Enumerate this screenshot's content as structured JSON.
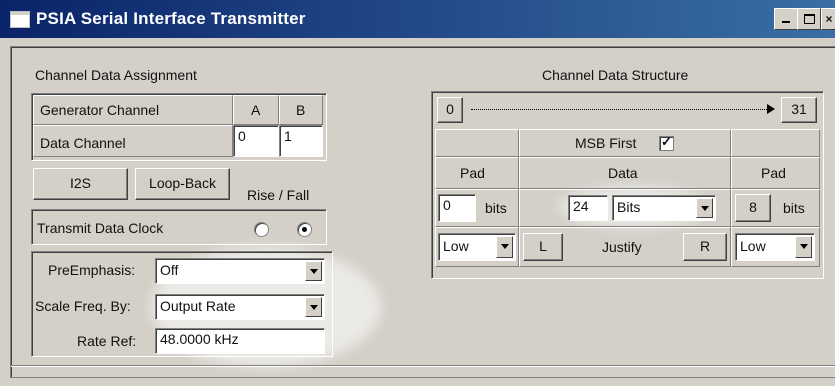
{
  "window": {
    "title": "PSIA Serial Interface Transmitter"
  },
  "assignment": {
    "title": "Channel Data Assignment",
    "generator_label": "Generator Channel",
    "data_label": "Data Channel",
    "col_a": "A",
    "col_b": "B",
    "data_a": "0",
    "data_b": "1",
    "i2s_label": "I2S",
    "loopback_label": "Loop-Back",
    "rise_fall_label": "Rise / Fall",
    "transmit_clock_label": "Transmit Data Clock",
    "rise_selected": false,
    "fall_selected": true
  },
  "emphasis": {
    "preemphasis_label": "PreEmphasis:",
    "preemphasis_value": "Off",
    "scale_label": "Scale Freq. By:",
    "scale_value": "Output Rate",
    "rate_label": "Rate Ref:",
    "rate_value": "48.0000 kHz"
  },
  "structure": {
    "title": "Channel Data Structure",
    "start_label": "0",
    "end_label": "31",
    "msb_label": "MSB First",
    "msb_checked": true,
    "pad_left_label": "Pad",
    "data_label": "Data",
    "pad_right_label": "Pad",
    "pad_left_value": "0",
    "pad_left_unit": "bits",
    "data_value": "24",
    "data_unit": "Bits",
    "pad_right_value": "8",
    "pad_right_unit": "bits",
    "pad_left_level": "Low",
    "justify_l": "L",
    "justify_label": "Justify",
    "justify_r": "R",
    "pad_right_level": "Low"
  }
}
